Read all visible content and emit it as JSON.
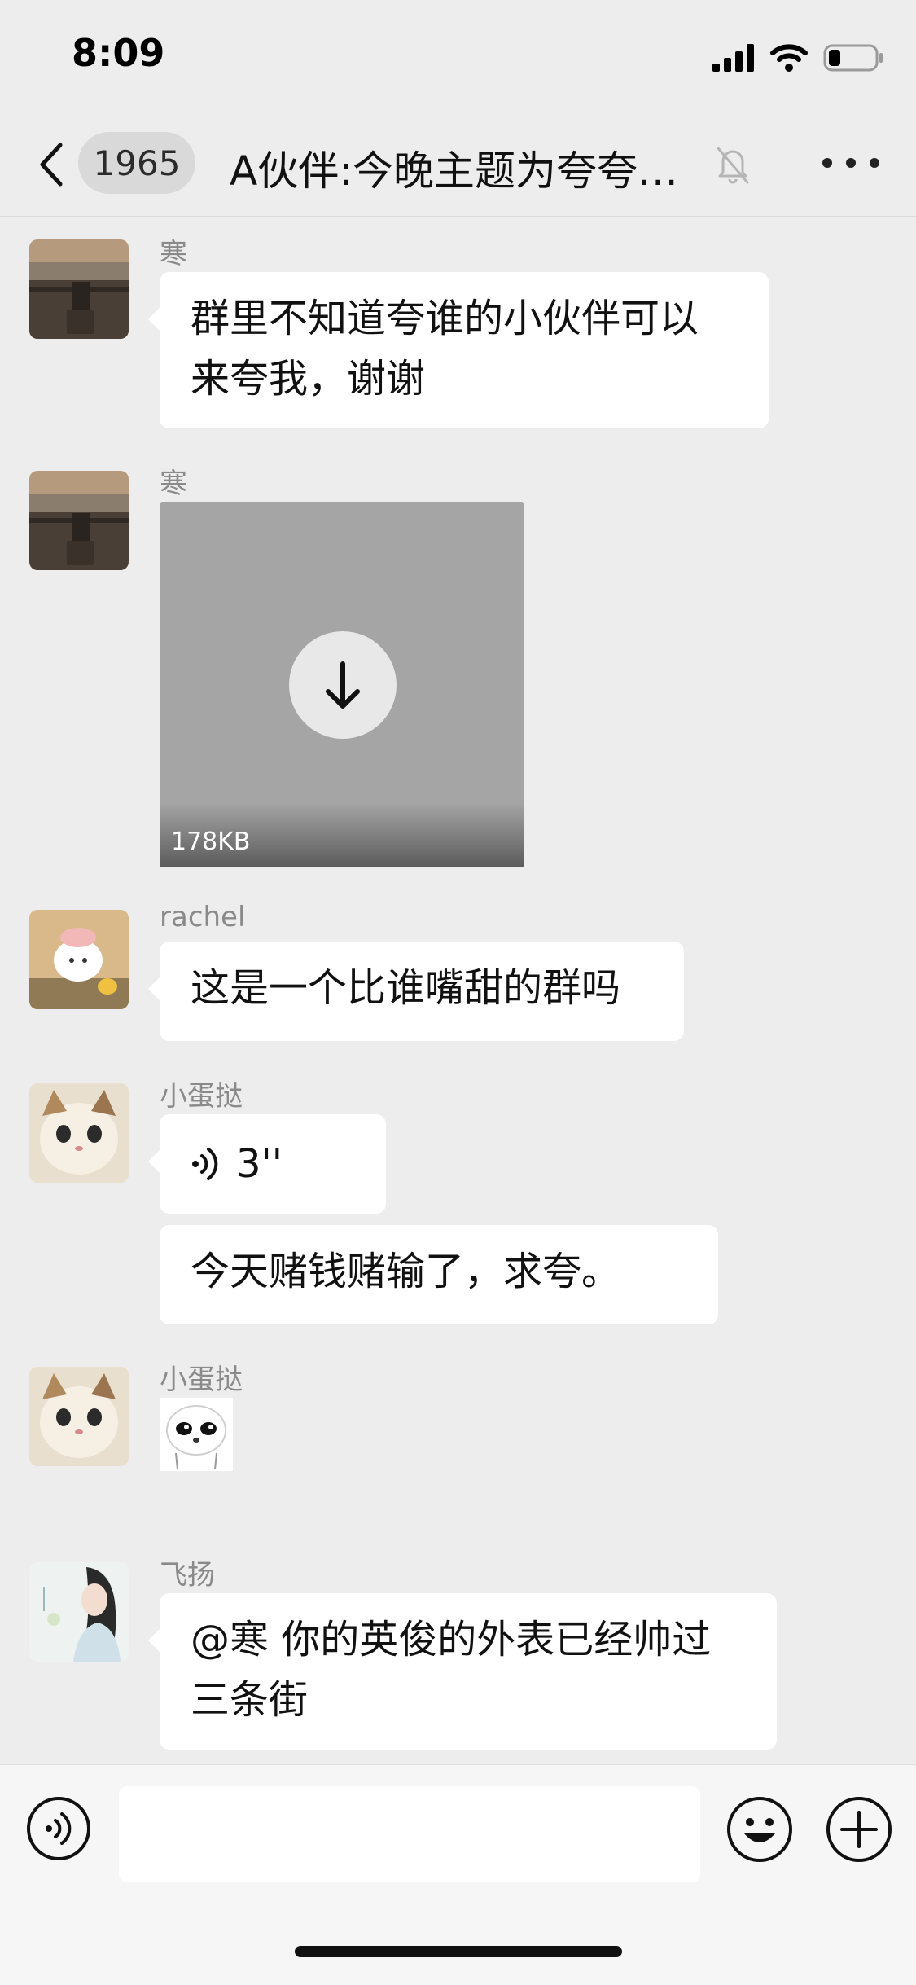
{
  "status_bar": {
    "time": "8:09",
    "battery_level": 0.25
  },
  "nav": {
    "back_label": "<",
    "unread_count": "1965",
    "title": "A伙伴:今晚主题为夸夸…",
    "muted": true
  },
  "messages": [
    {
      "sender": "寒",
      "type": "text",
      "lines": [
        "群里不知道夸谁的小伙伴可以",
        "来夸我，谢谢"
      ]
    },
    {
      "sender": "寒",
      "type": "file",
      "size": "178KB"
    },
    {
      "sender": "rachel",
      "type": "text",
      "lines": [
        "这是一个比谁嘴甜的群吗"
      ]
    },
    {
      "sender": "小蛋挞",
      "type": "voice",
      "duration": "3''"
    },
    {
      "type": "text",
      "lines": [
        "今天赌钱赌输了，求夸。"
      ]
    },
    {
      "sender": "小蛋挞",
      "type": "sticker"
    },
    {
      "sender": "飞扬",
      "type": "text",
      "lines": [
        "@寒 你的英俊的外表已经帅过",
        "三条街"
      ]
    }
  ],
  "input": {
    "placeholder": ""
  },
  "icons": {
    "back": "chevron-left-icon",
    "mute": "bell-slash-icon",
    "more": "ellipsis-icon",
    "download": "arrow-down-icon",
    "voice": "voice-wave-icon",
    "emoji": "smiley-icon",
    "plus": "plus-circle-icon"
  },
  "colors": {
    "background": "#ededed",
    "bubble": "#ffffff",
    "accent_text": "#8a8a8a"
  }
}
